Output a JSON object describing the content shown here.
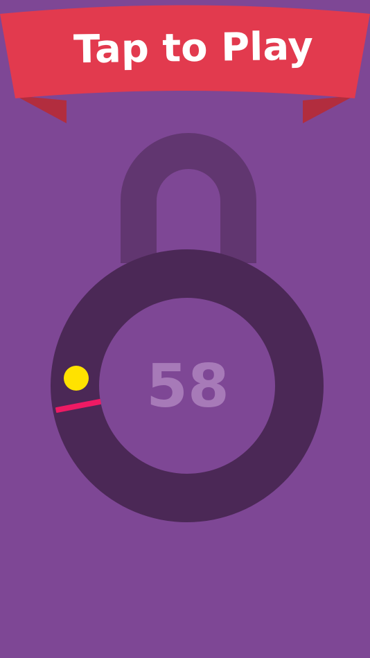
{
  "banner": {
    "text": "Tap to Play",
    "color": "#e23a4e",
    "tail_color": "#b22d3e"
  },
  "game": {
    "level": "58",
    "background_color": "#7e4795",
    "shackle_color": "#613670",
    "lock_ring_color": "#4b2856",
    "lock_center_color": "#7e4795",
    "level_text_color": "#a77ab8",
    "dot_color": "#ffe200",
    "target_bar_color": "#ee1a64"
  }
}
